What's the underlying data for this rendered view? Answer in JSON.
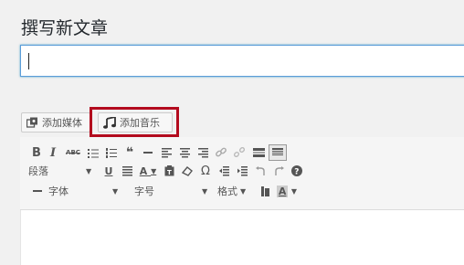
{
  "page": {
    "title": "撰写新文章"
  },
  "title_field": {
    "value": ""
  },
  "media_buttons": {
    "add_media": {
      "label": "添加媒体",
      "icon": "media-icon"
    },
    "add_music": {
      "label": "添加音乐",
      "icon": "music-note-icon"
    }
  },
  "toolbar": {
    "row1": [
      {
        "name": "bold-icon",
        "glyph": "B"
      },
      {
        "name": "italic-icon",
        "glyph": "I"
      },
      {
        "name": "strikethrough-icon",
        "glyph": "ABC"
      },
      {
        "name": "bullet-list-icon",
        "glyph": "☰"
      },
      {
        "name": "numbered-list-icon",
        "glyph": "☰"
      },
      {
        "name": "blockquote-icon",
        "glyph": "❝"
      },
      {
        "name": "horizontal-rule-icon",
        "glyph": "—"
      },
      {
        "name": "align-left-icon",
        "glyph": "≡"
      },
      {
        "name": "align-center-icon",
        "glyph": "≡"
      },
      {
        "name": "align-right-icon",
        "glyph": "≡"
      },
      {
        "name": "link-icon",
        "glyph": "⛓"
      },
      {
        "name": "unlink-icon",
        "glyph": "⛓"
      },
      {
        "name": "read-more-icon",
        "glyph": "▬"
      },
      {
        "name": "toolbar-toggle-icon",
        "glyph": "▦"
      }
    ],
    "format_select": {
      "label": "段落"
    },
    "row2": [
      {
        "name": "underline-icon",
        "glyph": "U"
      },
      {
        "name": "justify-icon",
        "glyph": "≡"
      },
      {
        "name": "text-color-icon",
        "glyph": "A"
      },
      {
        "name": "paste-text-icon",
        "glyph": "▣"
      },
      {
        "name": "clear-formatting-icon",
        "glyph": "◇"
      },
      {
        "name": "special-char-icon",
        "glyph": "Ω"
      },
      {
        "name": "outdent-icon",
        "glyph": "⇤"
      },
      {
        "name": "indent-icon",
        "glyph": "⇥"
      },
      {
        "name": "undo-icon",
        "glyph": "↶"
      },
      {
        "name": "redo-icon",
        "glyph": "↷"
      },
      {
        "name": "help-icon",
        "glyph": "?"
      }
    ],
    "font_family_select": {
      "label": "字体"
    },
    "font_size_select": {
      "label": "字号"
    },
    "styles_menu": {
      "label": "格式"
    },
    "colors": {
      "accent": "#b30b1e",
      "icon": "#555555",
      "background": "#f1f1f1"
    }
  }
}
